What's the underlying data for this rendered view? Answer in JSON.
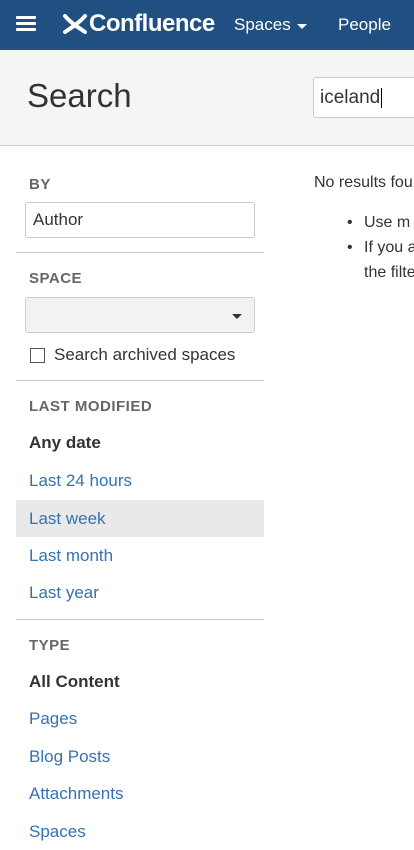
{
  "topbar": {
    "logo_text": "Confluence",
    "spaces_label": "Spaces",
    "people_label": "People"
  },
  "search": {
    "title": "Search",
    "query": "iceland"
  },
  "filters": {
    "by": {
      "title": "BY",
      "author_value": "Author"
    },
    "space": {
      "title": "SPACE",
      "selected": "",
      "archived_label": "Search archived spaces",
      "archived_checked": false
    },
    "last_modified": {
      "title": "LAST MODIFIED",
      "options": [
        "Any date",
        "Last 24 hours",
        "Last week",
        "Last month",
        "Last year"
      ]
    },
    "type": {
      "title": "TYPE",
      "options": [
        "All Content",
        "Pages",
        "Blog Posts",
        "Attachments",
        "Spaces"
      ]
    }
  },
  "results": {
    "message": "No results fou",
    "tips": [
      "Use m",
      "If you a",
      "the filte"
    ]
  },
  "colors": {
    "header_bg": "#205081",
    "link": "#3572b0",
    "selected_bg": "#e9e9e9"
  }
}
